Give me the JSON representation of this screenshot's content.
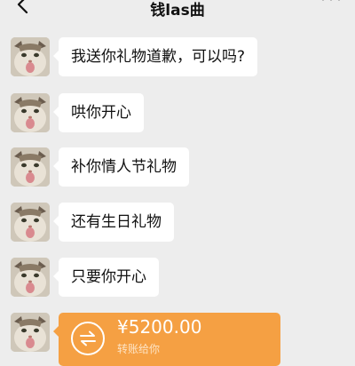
{
  "header": {
    "title": "钱las曲",
    "back_icon": "chevron-left-icon",
    "more_icon": "more-dots-icon"
  },
  "messages": [
    {
      "text": "我送你礼物道歉，可以吗?"
    },
    {
      "text": "哄你开心"
    },
    {
      "text": "补你情人节礼物"
    },
    {
      "text": "还有生日礼物"
    },
    {
      "text": "只要你开心"
    }
  ],
  "transfer": {
    "amount": "¥5200.00",
    "label": "转账给你",
    "color": "#f5a043",
    "icon": "transfer-arrows-icon"
  },
  "colors": {
    "background": "#ededed",
    "bubble": "#ffffff"
  }
}
